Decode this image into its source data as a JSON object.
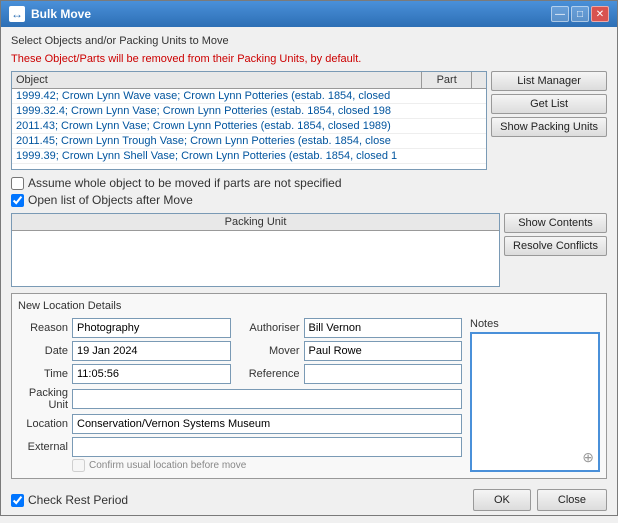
{
  "window": {
    "title": "Bulk Move",
    "icon": "↔"
  },
  "title_controls": {
    "minimize": "—",
    "maximize": "□",
    "close": "✕"
  },
  "section_header": "Select Objects and/or Packing Units to Move",
  "warning_text": "These Object/Parts will be removed from their Packing Units, by default.",
  "table": {
    "headers": {
      "object": "Object",
      "part": "Part"
    },
    "rows": [
      "1999.42; Crown Lynn Wave vase; Crown Lynn Potteries (estab. 1854, closed",
      "1999.32.4; Crown Lynn Vase; Crown Lynn Potteries (estab. 1854, closed 198",
      "2011.43; Crown Lynn Vase; Crown Lynn Potteries (estab. 1854, closed 1989)",
      "2011.45; Crown Lynn Trough Vase; Crown Lynn Potteries (estab. 1854, close",
      "1999.39; Crown Lynn Shell Vase; Crown Lynn Potteries (estab. 1854, closed 1"
    ]
  },
  "right_buttons": {
    "list_manager": "List Manager",
    "get_list": "Get List",
    "show_packing_units": "Show Packing Units"
  },
  "checkboxes": {
    "assume_whole": {
      "label": "Assume whole object to be moved if parts are not specified",
      "checked": false
    },
    "open_list": {
      "label": "Open list of Objects after Move",
      "checked": true
    }
  },
  "packing_unit_header": "Packing Unit",
  "packing_buttons": {
    "show_contents": "Show Contents",
    "resolve_conflicts": "Resolve Conflicts"
  },
  "new_location": {
    "title": "New Location Details",
    "fields": {
      "reason_label": "Reason",
      "reason_value": "Photography",
      "authoriser_label": "Authoriser",
      "authoriser_value": "Bill Vernon",
      "notes_label": "Notes",
      "date_label": "Date",
      "date_value": "19 Jan 2024",
      "mover_label": "Mover",
      "mover_value": "Paul Rowe",
      "time_label": "Time",
      "time_value": "11:05:56",
      "reference_label": "Reference",
      "reference_value": "",
      "packing_unit_label": "Packing Unit",
      "packing_unit_value": "",
      "location_label": "Location",
      "location_value": "Conservation/Vernon Systems Museum",
      "external_label": "External",
      "external_value": ""
    },
    "confirm_text": "Confirm usual location before move"
  },
  "bottom": {
    "check_rest_label": "Check Rest Period",
    "check_rest_checked": true,
    "ok_label": "OK",
    "close_label": "Close"
  }
}
